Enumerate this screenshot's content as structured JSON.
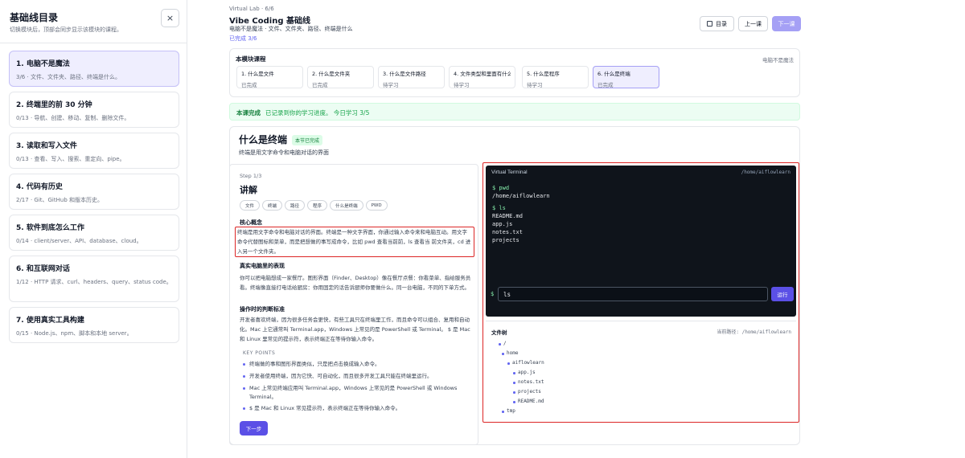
{
  "sidebar": {
    "title": "基础线目录",
    "subtitle": "切换模块后，顶部会同步显示该模块的课程。",
    "close_icon": "×",
    "modules": [
      {
        "title": "1. 电脑不是魔法",
        "desc": "3/6 · 文件、文件夹、路径、终端是什么。",
        "active": true
      },
      {
        "title": "2. 终端里的前 30 分钟",
        "desc": "0/13 · 导航、创建、移动、复制、删除文件。"
      },
      {
        "title": "3. 读取和写入文件",
        "desc": "0/13 · 查看、写入、搜索、重定向、pipe。"
      },
      {
        "title": "4. 代码有历史",
        "desc": "2/17 · Git、GitHub 和版本历史。"
      },
      {
        "title": "5. 软件到底怎么工作",
        "desc": "0/14 · client/server、API、database、cloud。"
      },
      {
        "title": "6. 和互联网对话",
        "desc": "1/12 · HTTP 请求、curl、headers、query、status code。"
      },
      {
        "title": "7. 使用真实工具构建",
        "desc": "0/15 · Node.js、npm、脚本和本地 server。"
      }
    ]
  },
  "header": {
    "crumb": "Virtual Lab · 6/6",
    "title": "Vibe Coding 基础线",
    "subtitle": "电脑不是魔法 · 文件、文件夹、路径、终端是什么",
    "progress": "已完成 3/6",
    "toc_label": "目录",
    "prev_label": "上一课",
    "next_label": "下一课"
  },
  "module_courses": {
    "label": "本模块课程",
    "right": "电脑不是魔法",
    "lessons": [
      {
        "title": "1. 什么是文件",
        "status": "已完成"
      },
      {
        "title": "2. 什么是文件夹",
        "status": "已完成"
      },
      {
        "title": "3. 什么是文件路径",
        "status": "待学习"
      },
      {
        "title": "4. 文件类型和里面有什么",
        "status": "待学习"
      },
      {
        "title": "5. 什么是程序",
        "status": "待学习"
      },
      {
        "title": "6. 什么是终端",
        "status": "已完成",
        "active": true
      }
    ]
  },
  "banner": {
    "bold": "本课完成",
    "text": "已记录到你的学习进度。 今日学习 3/5"
  },
  "lesson": {
    "title": "什么是终端",
    "badge": "本节已完成",
    "subtitle": "终端是用文字命令和电脑对话的界面",
    "step": "Step 1/3",
    "heading": "讲解",
    "tags": [
      "文件",
      "终端",
      "路径",
      "程序",
      "什么是终端",
      "PWD"
    ],
    "s1_title": "核心概念",
    "s1_text": "终端是用文字命令和电脑对话的界面。终端是一种文字界面，你通过输入命令来和电脑互动。用文字命令代替图标和菜单，而是把想做的事写成命令，比如 pwd 查看当前前，ls 查看当 前文件夹，cd 进入另一个文件夹。",
    "s2_title": "真实电脑里的表现",
    "s2_text": "你可以把电脑想成一家餐厅。图形界面（Finder、Desktop）像在餐厅点餐：你看菜单、指给服务员看。终端像直接打电话给厨房：你用固定的话告诉厨师你要做什么。同一台电脑，不同的下单方式。",
    "s3_title": "操作时的判断标准",
    "s3_text": "开发者喜欢终端，因为很多任务会更快，有些工具只在终端里工作，而且命令可以组合、复用和自动化。Mac 上它通常叫 Terminal.app，Windows 上常见的是 PowerShell 或 Terminal。 $ 是 Mac 和 Linux 里常见的提示符，表示终端正在等待你输入命令。",
    "kp_label": "KEY POINTS",
    "key_points": [
      "终端做的事和图形界面类似，只是把点击换成输入命令。",
      "开发者使用终端，因为它快、可自动化，而且很多开发工具只能在终端里运行。",
      "Mac 上常见终端应用叫 Terminal.app，Windows 上常见的是 PowerShell 或 Windows Terminal。",
      "$ 是 Mac 和 Linux 常见提示符，表示终端正在等待你输入命令。"
    ],
    "next_step": "下一步"
  },
  "terminal": {
    "title": "Virtual Terminal",
    "path": "/home/aiflowlearn",
    "lines": [
      {
        "text": "$ pwd",
        "cmd": true
      },
      {
        "text": "/home/aiflowlearn"
      },
      {
        "text": "$ ls",
        "cmd": true
      },
      {
        "text": "README.md"
      },
      {
        "text": "app.js"
      },
      {
        "text": "notes.txt"
      },
      {
        "text": "projects"
      }
    ],
    "prompt": "$",
    "input_value": "ls",
    "run_label": "运行"
  },
  "filetree": {
    "label": "文件树",
    "cwd": "当前路径: /home/aiflowlearn",
    "nodes": [
      "/",
      "home",
      "aiflowlearn",
      "app.js",
      "notes.txt",
      "projects",
      "README.md",
      "tmp"
    ]
  }
}
